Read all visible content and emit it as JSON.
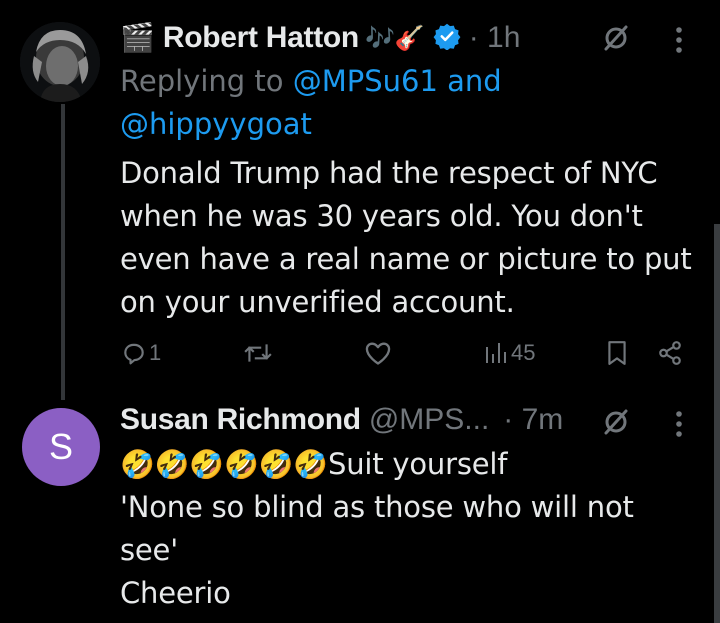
{
  "tweet1": {
    "icon_emoji": "🎬",
    "display_name": "Robert Hatton",
    "name_emojis": "🎶🎸",
    "time": "· 1h",
    "replying_prefix": "Replying to",
    "replying_handle1": "@MPSu61",
    "replying_and": "and",
    "replying_handle2": "@hippyygoat",
    "text": "Donald Trump had the respect of NYC when he was 30 years old. You don't even have a real name or picture to put on your unverified account.",
    "views": "45"
  },
  "tweet2": {
    "avatar_letter": "S",
    "display_name": "Susan Richmond",
    "handle": "@MPS...",
    "time": "· 7m",
    "emojis": "🤣🤣🤣🤣🤣🤣",
    "line1": "Suit yourself",
    "line2": "'None so blind as those who will not see'",
    "line3": "Cheerio"
  },
  "colors": {
    "background": "#000000",
    "text": "#e7e9ea",
    "muted": "#71767b",
    "link": "#1d9bf0",
    "avatar_purple": "#8b5fc4"
  },
  "icons": [
    "grok-icon",
    "more-icon",
    "reply-icon",
    "retweet-icon",
    "like-icon",
    "views-icon",
    "bookmark-icon",
    "share-icon",
    "verified-badge"
  ]
}
